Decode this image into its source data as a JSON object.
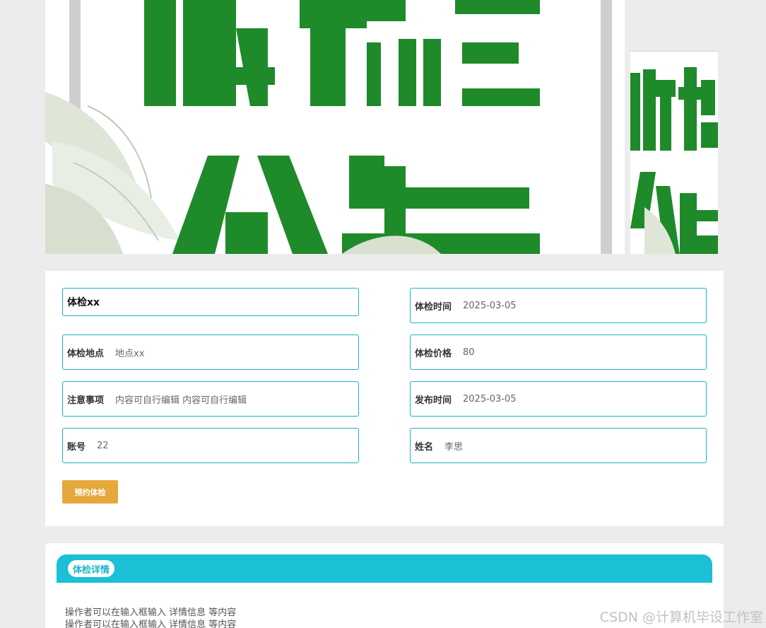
{
  "banner": {
    "main_text": "体检公告",
    "side_text": "体检公告"
  },
  "form": {
    "title": "体检xx",
    "fields": [
      {
        "label": "体检时间",
        "value": "2025-03-05"
      },
      {
        "label": "体检地点",
        "value": "地点xx"
      },
      {
        "label": "体检价格",
        "value": "80"
      },
      {
        "label": "注意事项",
        "value": "内容可自行编辑 内容可自行编辑"
      },
      {
        "label": "发布时间",
        "value": "2025-03-05"
      },
      {
        "label": "账号",
        "value": "22"
      },
      {
        "label": "姓名",
        "value": "李思"
      }
    ],
    "submit_label": "预约体检"
  },
  "details": {
    "tab_label": "体检详情",
    "lines": [
      "操作者可以在输入框输入  详情信息  等内容",
      "操作者可以在输入框输入  详情信息  等内容"
    ]
  },
  "watermark": "CSDN @计算机毕设工作室",
  "colors": {
    "accent": "#1bbfd6",
    "button": "#e5a83b",
    "banner_green": "#1f8a2a",
    "background": "#ececec"
  }
}
